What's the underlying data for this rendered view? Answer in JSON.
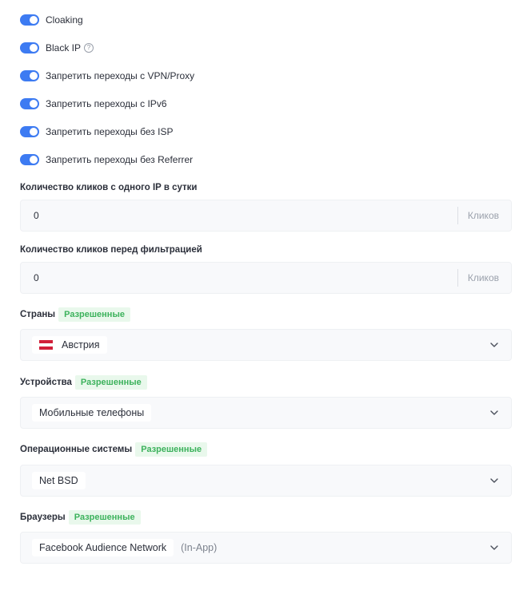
{
  "toggles": [
    {
      "label": "Cloaking",
      "on": true
    },
    {
      "label": "Black IP",
      "on": true,
      "help": true
    },
    {
      "label": "Запретить переходы с VPN/Proxy",
      "on": true
    },
    {
      "label": "Запретить переходы с IPv6",
      "on": true
    },
    {
      "label": "Запретить переходы без ISP",
      "on": true
    },
    {
      "label": "Запретить переходы без Referrer",
      "on": true
    }
  ],
  "help_glyph": "?",
  "clicks_per_ip": {
    "label": "Количество кликов с одного IP в сутки",
    "value": "0",
    "suffix": "Кликов"
  },
  "clicks_before_filter": {
    "label": "Количество кликов перед фильтрацией",
    "value": "0",
    "suffix": "Кликов"
  },
  "countries": {
    "label": "Страны",
    "badge": "Разрешенные",
    "selected": "Австрия",
    "flag": "austria-flag"
  },
  "devices": {
    "label": "Устройства",
    "badge": "Разрешенные",
    "selected": "Мобильные телефоны"
  },
  "os": {
    "label": "Операционные системы",
    "badge": "Разрешенные",
    "selected": "Net BSD"
  },
  "browsers": {
    "label": "Браузеры",
    "badge": "Разрешенные",
    "selected": "Facebook Audience Network",
    "selected_extra": "(In-App)"
  },
  "colors": {
    "accent": "#3d7bf2",
    "badge_bg": "#e9f8ec",
    "badge_text": "#3cb25c"
  }
}
